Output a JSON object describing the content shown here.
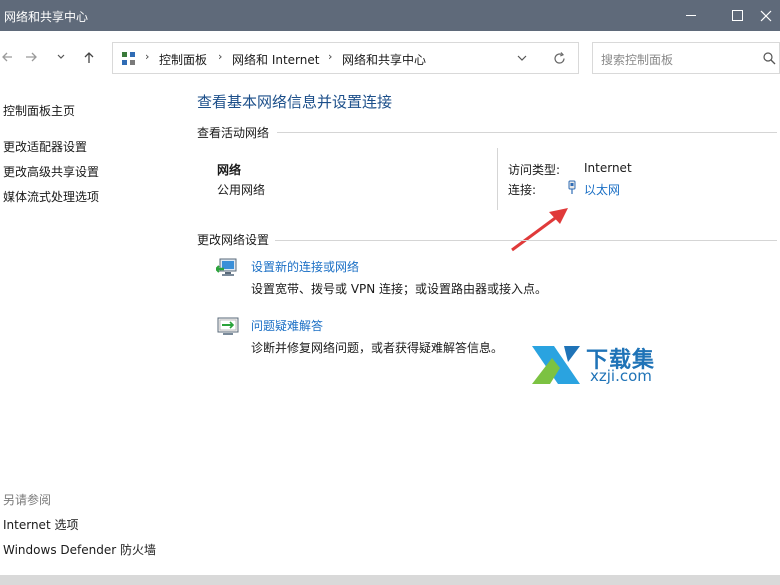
{
  "window": {
    "title": "网络和共享中心"
  },
  "address": {
    "crumbs": [
      "控制面板",
      "网络和 Internet",
      "网络和共享中心"
    ]
  },
  "search": {
    "placeholder": "搜索控制面板"
  },
  "sidebar": {
    "home": "控制面板主页",
    "links": [
      "更改适配器设置",
      "更改高级共享设置",
      "媒体流式处理选项"
    ],
    "see_also_title": "另请参阅",
    "see_also": [
      "Internet 选项",
      "Windows Defender 防火墙"
    ]
  },
  "main": {
    "title": "查看基本网络信息并设置连接",
    "active_networks_label": "查看活动网络",
    "network_name": "网络",
    "network_type": "公用网络",
    "access_type_label": "访问类型:",
    "access_type_value": "Internet",
    "connection_label": "连接:",
    "connection_value": "以太网",
    "change_settings_label": "更改网络设置",
    "tasks": [
      {
        "title": "设置新的连接或网络",
        "desc": "设置宽带、拨号或 VPN 连接；或设置路由器或接入点。"
      },
      {
        "title": "问题疑难解答",
        "desc": "诊断并修复网络问题，或者获得疑难解答信息。"
      }
    ]
  },
  "watermark": {
    "cn": "下载集",
    "en": "xzji.com"
  },
  "colors": {
    "titlebar": "#5f6a7a",
    "link": "#1a6fc5",
    "heading": "#1c4f8a",
    "arrow": "#e03a3a"
  }
}
